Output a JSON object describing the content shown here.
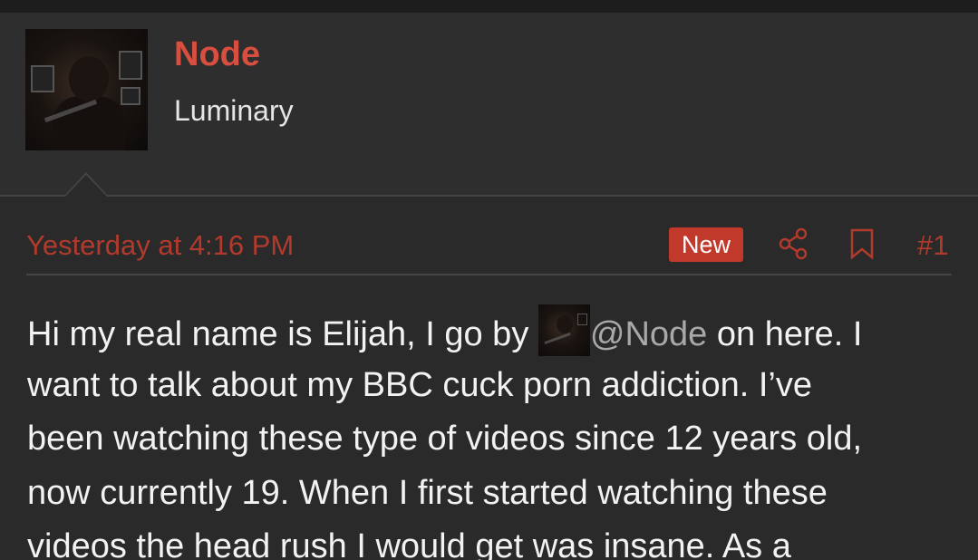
{
  "user": {
    "name": "Node",
    "title": "Luminary"
  },
  "post": {
    "date": "Yesterday at 4:16 PM",
    "badge": "New",
    "number": "#1",
    "line1_before": "Hi my real name is Elijah, I go by ",
    "mention": "@Node",
    "line1_after": " on here. I",
    "line2": "want to talk about my BBC cuck porn addiction. I’ve",
    "line3": "been watching these type of videos since 12 years old,",
    "line4": "now currently 19. When I first started watching these",
    "line5": "videos the head rush I would get was insane. As a"
  },
  "icons": {
    "share": "share-icon",
    "bookmark": "bookmark-icon"
  },
  "colors": {
    "accent": "#d94f3f",
    "date": "#b23a2d",
    "badge_bg": "#c0392b",
    "background": "#2a2a2a",
    "text": "#f2f2f2"
  }
}
